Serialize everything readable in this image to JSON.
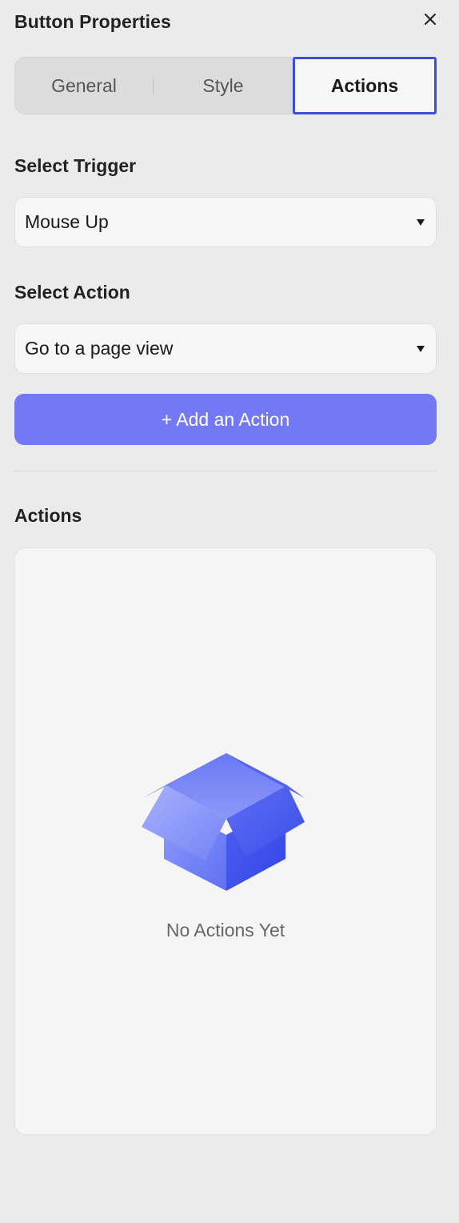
{
  "panel": {
    "title": "Button Properties"
  },
  "tabs": [
    {
      "label": "General",
      "active": false
    },
    {
      "label": "Style",
      "active": false
    },
    {
      "label": "Actions",
      "active": true
    }
  ],
  "trigger": {
    "label": "Select Trigger",
    "value": "Mouse Up"
  },
  "action": {
    "label": "Select Action",
    "value": "Go to a page view"
  },
  "add_button": {
    "label": "+ Add an Action"
  },
  "actions_section": {
    "label": "Actions",
    "empty_text": "No Actions Yet"
  },
  "icons": {
    "close": "close-icon",
    "caret": "caret-down-icon",
    "empty": "open-box-icon"
  },
  "colors": {
    "accent": "#7378f5",
    "active_tab_border": "#3b4fd6",
    "box_blue": "#4a5cf0"
  }
}
